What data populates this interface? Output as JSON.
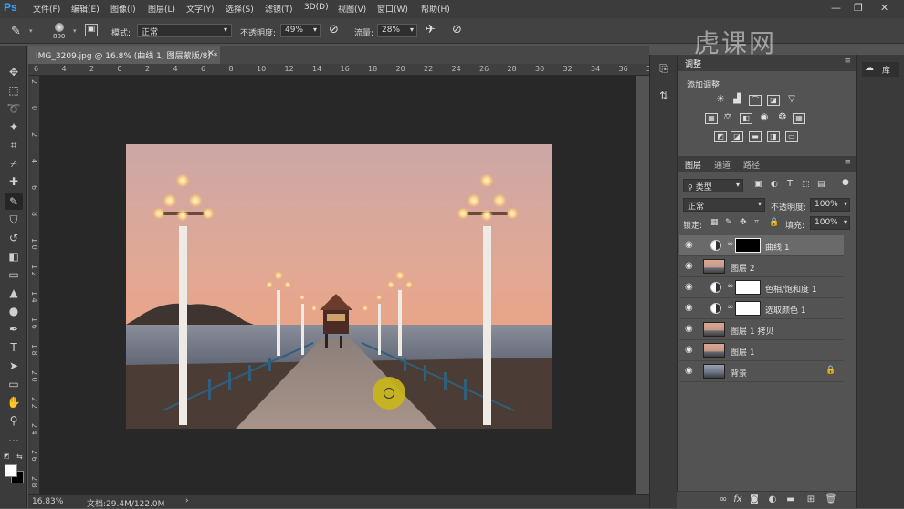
{
  "app": {
    "logo": "Ps"
  },
  "menu": [
    "文件(F)",
    "编辑(E)",
    "图像(I)",
    "图层(L)",
    "文字(Y)",
    "选择(S)",
    "滤镜(T)",
    "3D(D)",
    "视图(V)",
    "窗口(W)",
    "帮助(H)"
  ],
  "window_controls": {
    "minimize": "—",
    "restore": "❐",
    "close": "✕"
  },
  "options": {
    "brush_size": "800",
    "mode_label": "模式:",
    "mode_value": "正常",
    "opacity_label": "不透明度:",
    "opacity_value": "49%",
    "flow_label": "流量:",
    "flow_value": "28%"
  },
  "watermark": "虎课网",
  "document": {
    "tab_title": "IMG_3209.jpg @ 16.8% (曲线 1, 图层蒙版/8) *",
    "tab_close": "×"
  },
  "ruler": {
    "h_labels": [
      "6",
      "4",
      "2",
      "0",
      "2",
      "4",
      "6",
      "8",
      "10",
      "12",
      "14",
      "16",
      "18",
      "20",
      "22",
      "24",
      "26",
      "28",
      "30",
      "32",
      "34",
      "36",
      "38"
    ],
    "v_labels": [
      "2",
      "0",
      "2",
      "4",
      "6",
      "8",
      "1 0",
      "1 2",
      "1 4",
      "1 6",
      "1 8",
      "2 0",
      "2 2",
      "2 4",
      "2 6",
      "2 8"
    ]
  },
  "status": {
    "zoom": "16.83%",
    "doc_info": "文档:29.4M/122.0M",
    "arrow": "›"
  },
  "adjustments_panel": {
    "tab": "调整",
    "add_label": "添加调整"
  },
  "far_right": {
    "library_label": "库"
  },
  "layers_panel": {
    "tabs": [
      "图层",
      "通道",
      "路径"
    ],
    "filter_kind": "类型",
    "blend_mode": "正常",
    "opacity_label": "不透明度:",
    "opacity_value": "100%",
    "lock_label": "锁定:",
    "fill_label": "填充:",
    "fill_value": "100%",
    "layers": [
      {
        "name": "曲线 1",
        "type": "adjustment",
        "mask": "black",
        "selected": true
      },
      {
        "name": "图层 2",
        "type": "pixel",
        "selected": false
      },
      {
        "name": "色相/饱和度 1",
        "type": "adjustment",
        "mask": "white",
        "selected": false
      },
      {
        "name": "选取颜色 1",
        "type": "adjustment",
        "mask": "white",
        "selected": false
      },
      {
        "name": "图层 1 拷贝",
        "type": "pixel",
        "selected": false
      },
      {
        "name": "图层 1",
        "type": "pixel",
        "selected": false
      },
      {
        "name": "背景",
        "type": "background",
        "locked": true,
        "selected": false
      }
    ],
    "footer_icons": [
      "link-icon",
      "fx-icon",
      "mask-icon",
      "adjustment-icon",
      "folder-icon",
      "new-layer-icon",
      "trash-icon"
    ]
  },
  "colors": {
    "ps_blue": "#31a8ff",
    "canvas_bg": "#282828",
    "panel_bg": "#535353",
    "brush_cursor": "#c9b51b"
  }
}
